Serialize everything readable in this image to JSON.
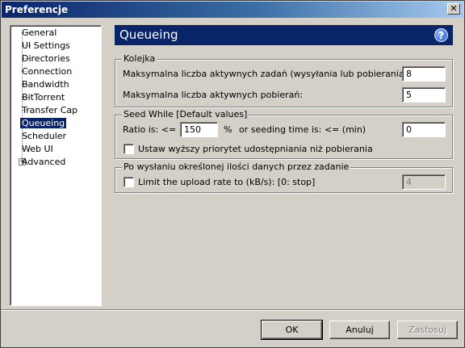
{
  "window": {
    "title": "Preferencje"
  },
  "tree": {
    "items": [
      {
        "label": "General"
      },
      {
        "label": "UI Settings"
      },
      {
        "label": "Directories"
      },
      {
        "label": "Connection"
      },
      {
        "label": "Bandwidth"
      },
      {
        "label": "BitTorrent"
      },
      {
        "label": "Transfer Cap"
      },
      {
        "label": "Queueing",
        "selected": true
      },
      {
        "label": "Scheduler"
      },
      {
        "label": "Web UI"
      },
      {
        "label": "Advanced",
        "expandable": true
      }
    ]
  },
  "header": {
    "title": "Queueing",
    "help_glyph": "?"
  },
  "kolejka": {
    "title": "Kolejka",
    "active_tasks_label": "Maksymalna liczba aktywnych zadań (wysyłania lub pobierania):",
    "active_tasks_value": "8",
    "active_downloads_label": "Maksymalna liczba aktywnych pobierań:",
    "active_downloads_value": "5"
  },
  "seed": {
    "title": "Seed While [Default values]",
    "ratio_label": "Ratio is:  <=",
    "ratio_value": "150",
    "percent_label": "%",
    "seeding_time_label": "or seeding time is: <= (min)",
    "seeding_time_value": "0",
    "priority_label": "Ustaw wyższy priorytet udostępniania niż pobierania"
  },
  "after": {
    "title": "Po wysłaniu określonej ilości danych przez zadanie",
    "limit_label": "Limit the upload rate to (kB/s): [0: stop]",
    "limit_value": "4"
  },
  "buttons": {
    "ok": "OK",
    "cancel": "Anuluj",
    "apply": "Zastosuj"
  }
}
